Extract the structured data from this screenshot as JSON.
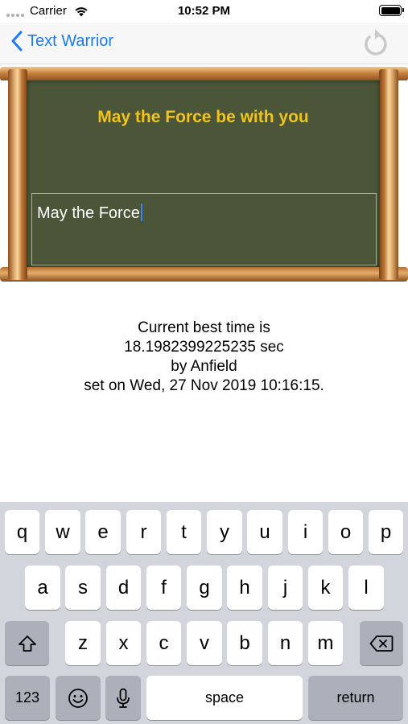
{
  "status_bar": {
    "carrier": "Carrier",
    "time": "10:52 PM",
    "icons": [
      "signal-dots-icon",
      "wifi-icon",
      "battery-icon"
    ]
  },
  "nav": {
    "back_label": "Text Warrior",
    "back_icon": "chevron-left-icon",
    "reset_icon": "reset-icon",
    "accent_color": "#1a7cf4"
  },
  "board": {
    "target_phrase": "May the Force be with you",
    "typed_text": "May the Force",
    "board_color": "#4a5637",
    "phrase_color": "#f2c319"
  },
  "record": {
    "line1": "Current best time is",
    "line2": "18.1982399225235 sec",
    "line3": "by Anfield",
    "line4": "set on Wed, 27 Nov 2019 10:16:15."
  },
  "keyboard": {
    "row1": [
      "q",
      "w",
      "e",
      "r",
      "t",
      "y",
      "u",
      "i",
      "o",
      "p"
    ],
    "row2": [
      "a",
      "s",
      "d",
      "f",
      "g",
      "h",
      "j",
      "k",
      "l"
    ],
    "row3": [
      "z",
      "x",
      "c",
      "v",
      "b",
      "n",
      "m"
    ],
    "numbers_label": "123",
    "space_label": "space",
    "return_label": "return",
    "icons": [
      "shift-icon",
      "delete-icon",
      "emoji-icon",
      "microphone-icon"
    ]
  }
}
